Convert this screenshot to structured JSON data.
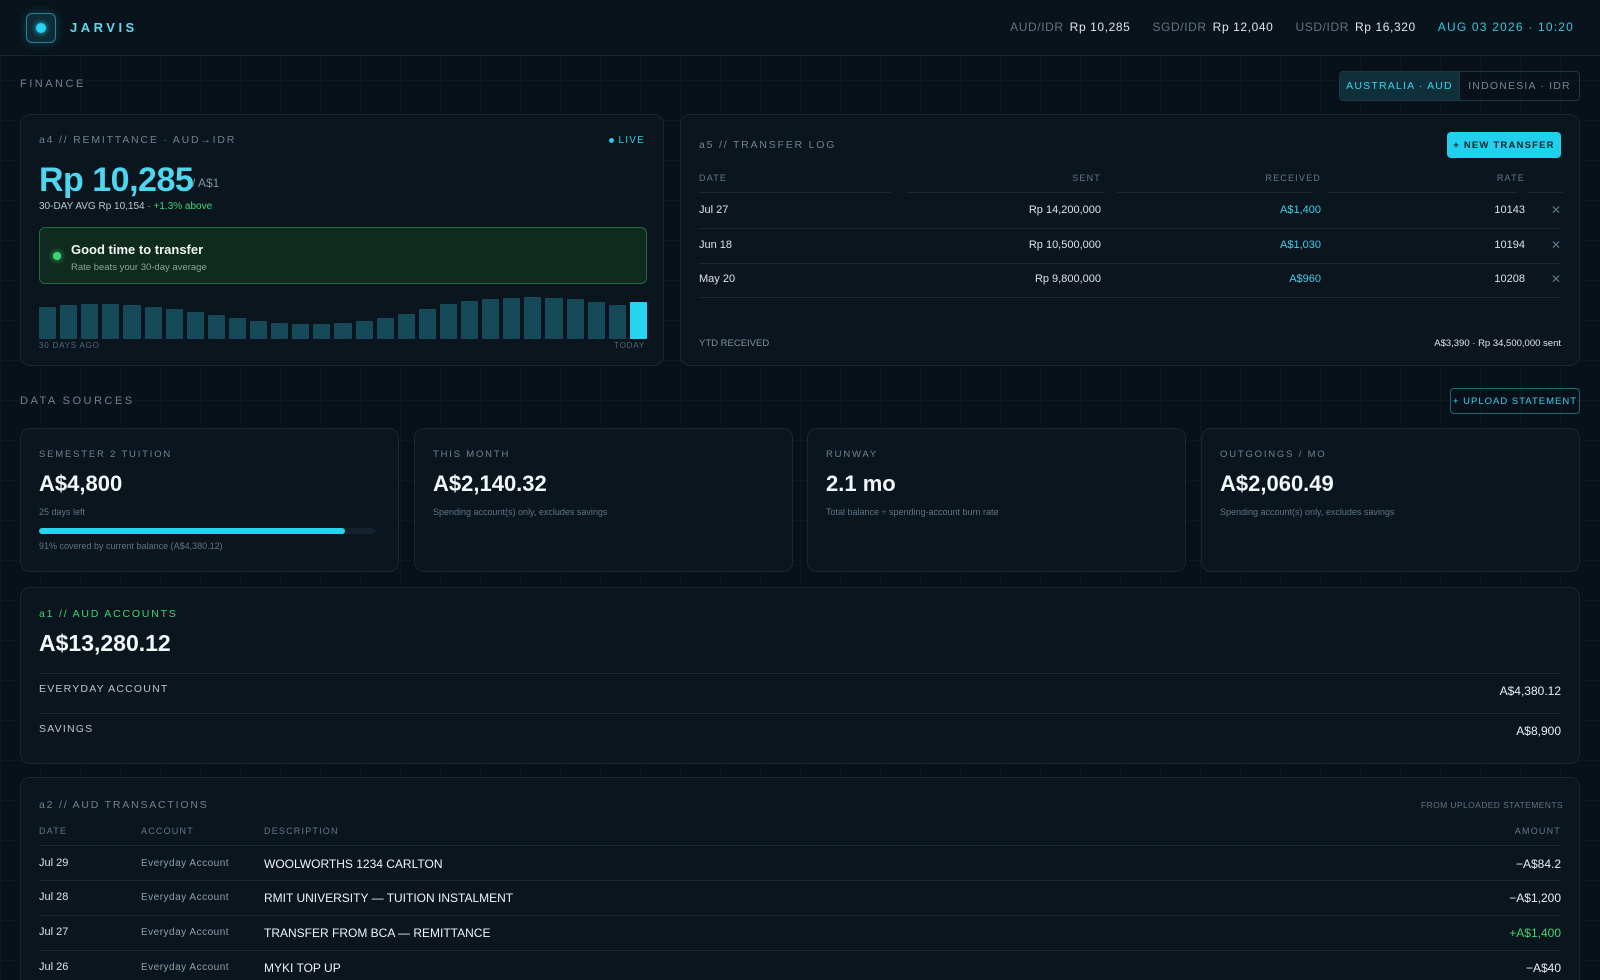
{
  "app": {
    "brand": "JARVIS",
    "rates": [
      {
        "label": "AUD/IDR",
        "value": "Rp 10,285"
      },
      {
        "label": "SGD/IDR",
        "value": "Rp 12,040"
      },
      {
        "label": "USD/IDR",
        "value": "Rp 16,320"
      }
    ],
    "datetime": "AUG 03 2026 · 10:20",
    "accent": "#27d4f0"
  },
  "finance": {
    "title": "FINANCE",
    "regions": [
      "AUSTRALIA · AUD",
      "INDONESIA · IDR"
    ],
    "active_region": "AUSTRALIA · AUD"
  },
  "remittance": {
    "label": "a4 // REMITTANCE · AUD→IDR",
    "live": "LIVE",
    "rate": "Rp 10,285",
    "per_unit": "/ A$1",
    "avg_prefix": "30-DAY AVG Rp 10,154 · ",
    "avg_change": "+1.3% above",
    "signal_title": "Good time to transfer",
    "signal_sub": "Rate beats your 30-day average",
    "axis_start": "30 DAYS AGO",
    "axis_end": "TODAY",
    "history": [
      32,
      34,
      35,
      35,
      34,
      32,
      30,
      27,
      24,
      21,
      18,
      16,
      15,
      15,
      16,
      18,
      21,
      25,
      30,
      35,
      38,
      40,
      41,
      42,
      41,
      40,
      37,
      34,
      37
    ]
  },
  "transfer_log": {
    "label": "a5 // TRANSFER LOG",
    "new_button": "+ NEW TRANSFER",
    "columns": [
      "DATE",
      "SENT",
      "RECEIVED",
      "RATE"
    ],
    "rows": [
      {
        "date": "Jul 27",
        "sent": "Rp 14,200,000",
        "received": "A$1,400",
        "rate": "10143"
      },
      {
        "date": "Jun 18",
        "sent": "Rp 10,500,000",
        "received": "A$1,030",
        "rate": "10194"
      },
      {
        "date": "May 20",
        "sent": "Rp 9,800,000",
        "received": "A$960",
        "rate": "10208"
      }
    ],
    "remove_glyph": "✕",
    "ytd_label": "YTD RECEIVED",
    "ytd_value": "A$3,390 · Rp 34,500,000 sent"
  },
  "data_sources": {
    "title": "DATA SOURCES",
    "upload_button": "+ UPLOAD STATEMENT"
  },
  "stats": [
    {
      "label": "SEMESTER 2 TUITION",
      "value": "A$4,800",
      "sub": "25 days left",
      "progress": 0.91,
      "note": "91% covered by current balance (A$4,380.12)"
    },
    {
      "label": "THIS MONTH",
      "value": "A$2,140.32",
      "sub": "Spending account(s) only, excludes savings"
    },
    {
      "label": "RUNWAY",
      "value": "2.1 mo",
      "sub": "Total balance ÷ spending-account burn rate"
    },
    {
      "label": "OUTGOINGS / MO",
      "value": "A$2,060.49",
      "sub": "Spending account(s) only, excludes savings"
    }
  ],
  "accounts": {
    "label": "a1 // AUD ACCOUNTS",
    "total": "A$13,280.12",
    "items": [
      {
        "name": "EVERYDAY ACCOUNT",
        "amount": "A$4,380.12"
      },
      {
        "name": "SAVINGS",
        "amount": "A$8,900"
      }
    ]
  },
  "transactions": {
    "label": "a2 // AUD TRANSACTIONS",
    "source_note": "FROM UPLOADED STATEMENTS",
    "columns": {
      "date": "DATE",
      "account": "ACCOUNT",
      "description": "DESCRIPTION",
      "amount": "AMOUNT"
    },
    "rows": [
      {
        "date": "Jul 29",
        "account": "Everyday Account",
        "description": "WOOLWORTHS 1234 CARLTON",
        "amount": "−A$84.2",
        "positive": false
      },
      {
        "date": "Jul 28",
        "account": "Everyday Account",
        "description": "RMIT UNIVERSITY — TUITION INSTALMENT",
        "amount": "−A$1,200",
        "positive": false
      },
      {
        "date": "Jul 27",
        "account": "Everyday Account",
        "description": "TRANSFER FROM BCA — REMITTANCE",
        "amount": "+A$1,400",
        "positive": true
      },
      {
        "date": "Jul 26",
        "account": "Everyday Account",
        "description": "MYKI TOP UP",
        "amount": "−A$40",
        "positive": false
      }
    ]
  }
}
